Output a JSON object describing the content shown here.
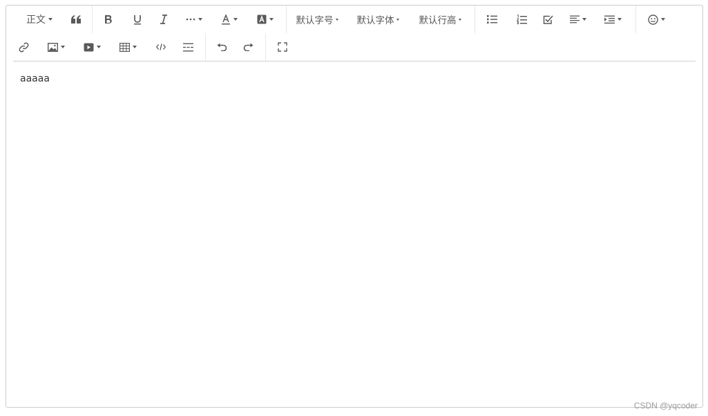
{
  "toolbar": {
    "header_label": "正文",
    "font_size_label": "默认字号",
    "font_family_label": "默认字体",
    "line_height_label": "默认行高"
  },
  "icons": {
    "header": "header-dropdown",
    "blockquote": "quote-icon",
    "bold": "bold-icon",
    "underline": "underline-icon",
    "italic": "italic-icon",
    "more": "more-icon",
    "font_color": "font-color-icon",
    "bg_color": "bg-color-icon",
    "bulleted_list": "bulleted-list-icon",
    "numbered_list": "numbered-list-icon",
    "todo": "todo-icon",
    "justify": "align-left-icon",
    "indent": "indent-icon",
    "emotion": "emoji-icon",
    "link": "link-icon",
    "image": "image-icon",
    "video": "video-icon",
    "table": "table-icon",
    "code": "code-icon",
    "divider": "divider-icon",
    "undo": "undo-icon",
    "redo": "redo-icon",
    "fullscreen": "fullscreen-icon"
  },
  "editor": {
    "content": "aaaaa"
  },
  "watermark": "CSDN @yqcoder",
  "colors": {
    "border": "#cccccc",
    "icon": "#595959",
    "divider": "#e8e8e8"
  }
}
